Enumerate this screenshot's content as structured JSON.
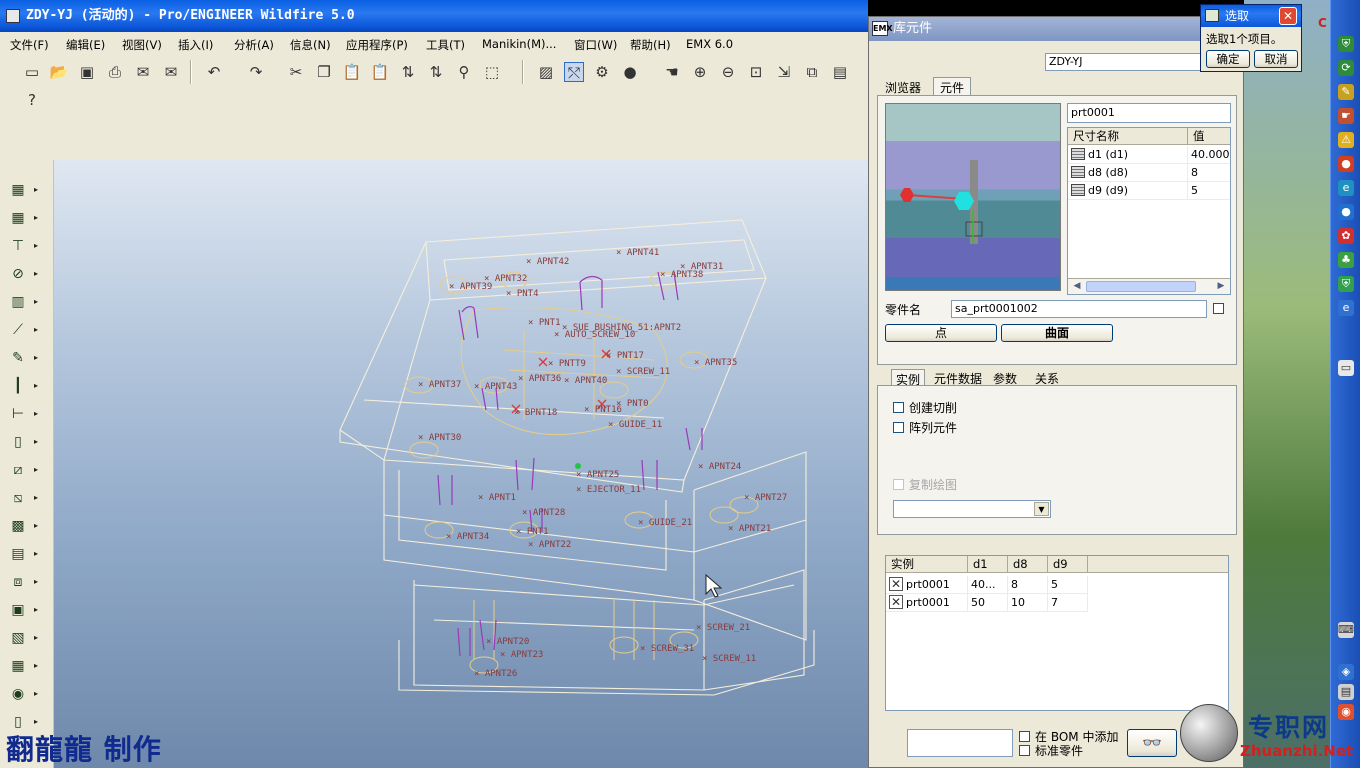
{
  "main_window": {
    "title": "ZDY-YJ (活动的) - Pro/ENGINEER Wildfire 5.0",
    "menus": [
      "文件(F)",
      "编辑(E)",
      "视图(V)",
      "插入(I)",
      "分析(A)",
      "信息(N)",
      "应用程序(P)",
      "工具(T)",
      "Manikin(M)...",
      "窗口(W)",
      "帮助(H)",
      "EMX 6.0"
    ],
    "watermark": "翻龍龍 制作"
  },
  "library_dialog": {
    "title": "库元件",
    "assembly_field": "ZDY-YJ",
    "tabs": [
      "浏览器",
      "元件"
    ],
    "part_field": "prt0001",
    "dim_table": {
      "headers": [
        "尺寸名称",
        "值"
      ],
      "rows": [
        {
          "name": "d1 (d1)",
          "value": "40.000"
        },
        {
          "name": "d8 (d8)",
          "value": "8"
        },
        {
          "name": "d9 (d9)",
          "value": "5"
        }
      ]
    },
    "part_name_label": "零件名",
    "part_name_value": "sa_prt0001002",
    "point_button": "点",
    "surface_button": "曲面",
    "sub_tabs": [
      "实例",
      "元件数据",
      "参数",
      "关系"
    ],
    "create_cut_label": "创建切削",
    "array_element_label": "阵列元件",
    "copy_drawing_label": "复制绘图",
    "instance_table": {
      "headers": [
        "实例",
        "d1",
        "d8",
        "d9"
      ],
      "rows": [
        {
          "name": "prt0001",
          "d1": "40...",
          "d8": "8",
          "d9": "5"
        },
        {
          "name": "prt0001",
          "d1": "50",
          "d8": "10",
          "d9": "7"
        }
      ]
    },
    "bom_label": "在 BOM 中添加",
    "std_part_label": "标准零件"
  },
  "select_popup": {
    "title": "选取",
    "message": "选取1个项目。",
    "ok": "确定",
    "cancel": "取消"
  },
  "desktop": {
    "logo_cn": "专职网",
    "logo_en": "Zhuanzhi.Net",
    "corner_letter": "C"
  },
  "model_labels": [
    "APNT42",
    "APNT41",
    "APNT32",
    "APNT39",
    "PNT4",
    "APNT31",
    "APNT38",
    "PNT1",
    "SUE_BUSHING_51:APNT2",
    "AUTO_SCREW_10",
    "PNTT9",
    "PNT17",
    "APNT35",
    "APNT36",
    "APNT40",
    "SCREW_11",
    "APNT37",
    "APNT43",
    "BPNT18",
    "PNT16",
    "PNT0",
    "GUIDE_11",
    "APNT30",
    "APNT24",
    "APNT25",
    "EJECTOR_11",
    "APNT1",
    "APNT27",
    "APNT28",
    "GUIDE_21",
    "APNT21",
    "APNT34",
    "PNT1",
    "APNT22",
    "APNT20",
    "APNT23",
    "SCREW_31",
    "SCREW_21",
    "APNT26",
    "SCREW_11"
  ]
}
